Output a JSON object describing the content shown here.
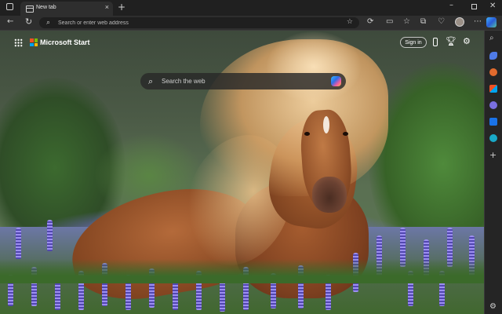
{
  "tab": {
    "title": "New tab",
    "favicon": "new-tab-page-icon"
  },
  "address_bar": {
    "placeholder": "Search or enter web address"
  },
  "start_page": {
    "brand": "Microsoft Start",
    "sign_in_label": "Sign in",
    "search_placeholder": "Search the web"
  },
  "colors": {
    "chrome_dark": "#202020",
    "toolbar": "#2e2e2e",
    "ms_red": "#f25022",
    "ms_green": "#7fba00",
    "ms_blue": "#00a4ef",
    "ms_yellow": "#ffb900"
  },
  "icons": {
    "tab_actions": "tab-actions-icon",
    "new_tab": "plus-icon",
    "back": "arrow-left-icon",
    "refresh": "refresh-icon",
    "favorite": "star-icon",
    "apps": "apps-grid-icon",
    "phone": "phone-icon",
    "rewards": "trophy-icon",
    "settings": "gear-icon"
  }
}
